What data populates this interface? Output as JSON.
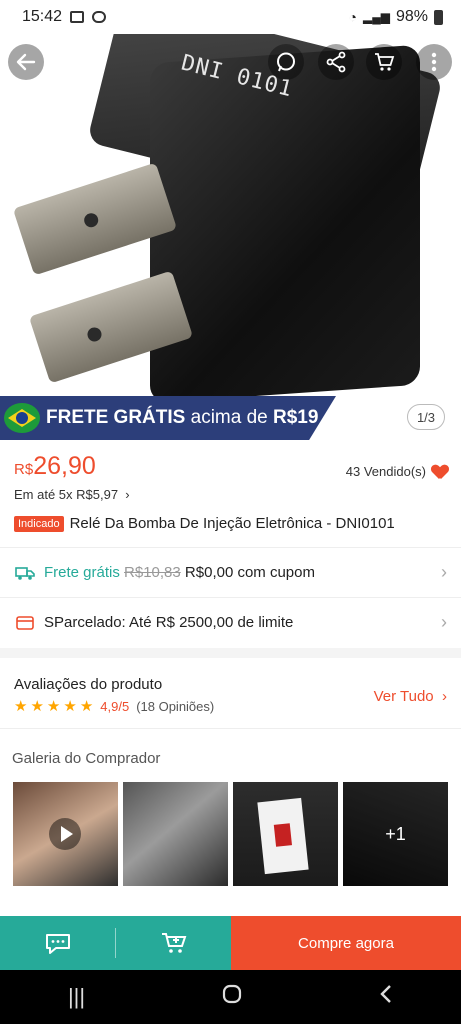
{
  "status_bar": {
    "time": "15:42",
    "battery": "98%"
  },
  "hero": {
    "relay_print": "DNI 0101",
    "image_counter": "1/3",
    "frete_banner": {
      "bold": "FRETE GRÁTIS",
      "rest": "acima de",
      "amount": "R$19"
    }
  },
  "price": {
    "currency": "R$",
    "value": "26,90",
    "installments": "Em até 5x R$5,97",
    "sold": "43 Vendido(s)"
  },
  "product": {
    "badge": "Indicado",
    "title": "Relé Da Bomba De Injeção Eletrônica - DNI0101"
  },
  "shipping": {
    "label": "Frete grátis",
    "old_price": "R$10,83",
    "new_text": "R$0,00 com cupom"
  },
  "sparcelado": {
    "text": "SParcelado: Até R$ 2500,00 de limite"
  },
  "reviews": {
    "title": "Avaliações do produto",
    "rating": "4,9/5",
    "count": "(18 Opiniões)",
    "see_all": "Ver Tudo"
  },
  "gallery": {
    "title": "Galeria do Comprador",
    "more_count": "+1"
  },
  "bottom_bar": {
    "buy_label": "Compre agora"
  },
  "colors": {
    "accent": "#ee4d2d",
    "teal": "#26aa99",
    "banner": "#2c3e7a"
  }
}
